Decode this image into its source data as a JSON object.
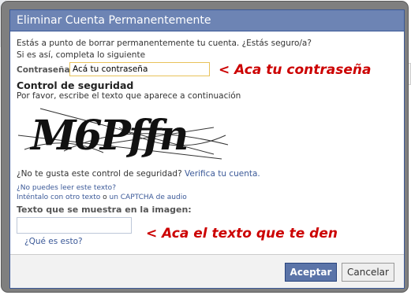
{
  "dialog": {
    "title": "Eliminar Cuenta Permanentemente",
    "intro_line1": "Estás a punto de borrar permanentemente tu cuenta. ¿Estás seguro/a?",
    "intro_line2": "Si es así, completa lo siguiente",
    "password_label": "Contraseña",
    "password_value": "Acá tu contraseña",
    "security_heading": "Control de seguridad",
    "security_instruction": "Por favor, escribe el texto que aparece a continuación",
    "captcha_text": "M6Pffn",
    "dislike_prefix": "¿No te gusta este control de seguridad?",
    "verify_link": "Verifica tu cuenta.",
    "cant_read": "¿No puedes leer este texto?",
    "try_another": "Inténtalo con otro texto",
    "or_word": "o",
    "audio_link": "un CAPTCHA de audio",
    "image_text_label": "Texto que se muestra en la imagen:",
    "whats_this": "¿Qué es esto?",
    "accept_button": "Aceptar",
    "cancel_button": "Cancelar"
  },
  "annotations": {
    "password_note": "< Aca tu contraseña",
    "captcha_note": "< Aca el texto que te den"
  },
  "colors": {
    "titlebar": "#6d84b4",
    "link": "#3b5998",
    "annotation": "#cc0000",
    "primary_button": "#5b74a8"
  }
}
